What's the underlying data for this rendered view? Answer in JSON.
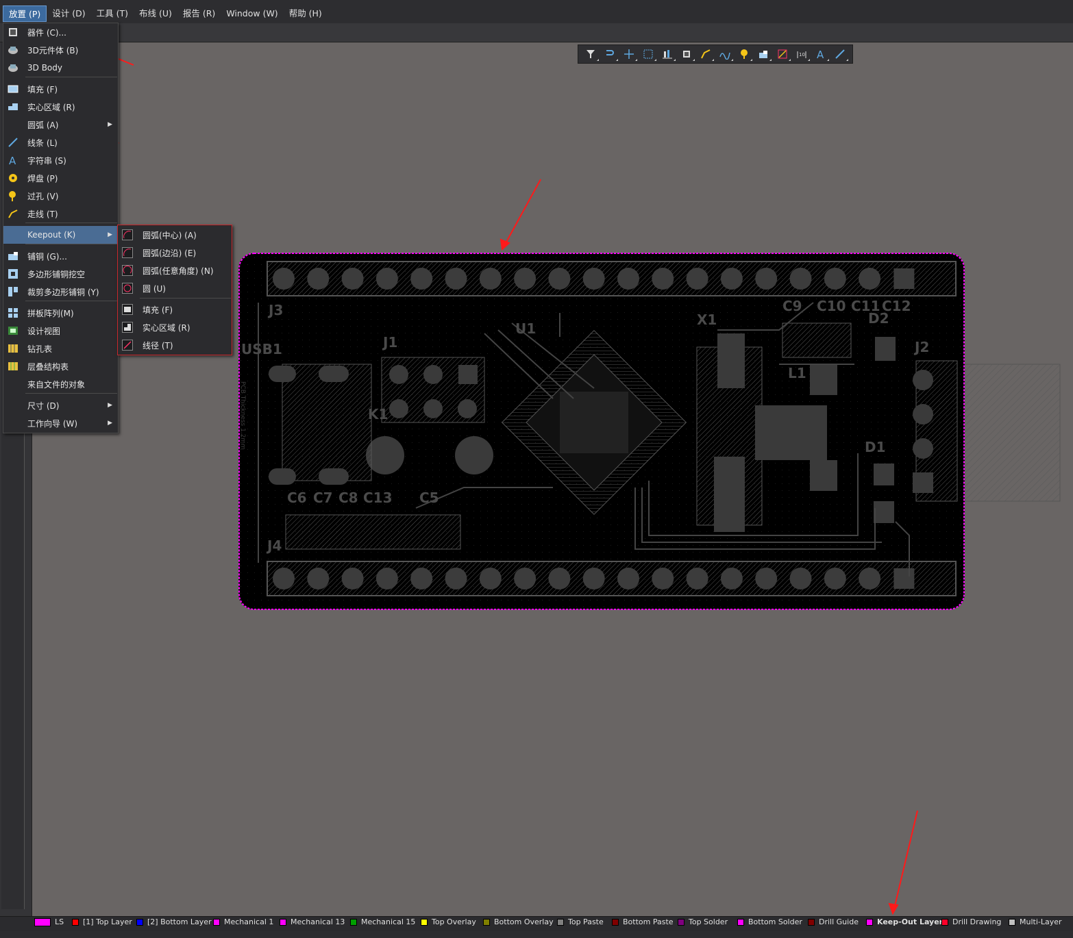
{
  "menubar": {
    "items": [
      "放置 (P)",
      "设计 (D)",
      "工具 (T)",
      "布线 (U)",
      "报告 (R)",
      "Window (W)",
      "帮助 (H)"
    ]
  },
  "place_menu": {
    "items": [
      {
        "label": "器件 (C)...",
        "icon": "component-icon"
      },
      {
        "label": "3D元件体 (B)",
        "icon": "3d-body-icon"
      },
      {
        "label": "3D Body",
        "icon": "3d-body-icon"
      },
      {
        "label": "填充 (F)",
        "icon": "fill-icon"
      },
      {
        "label": "实心区域 (R)",
        "icon": "solid-region-icon"
      },
      {
        "label": "圆弧 (A)",
        "icon": "",
        "submenu": true
      },
      {
        "label": "线条 (L)",
        "icon": "line-icon"
      },
      {
        "label": "字符串 (S)",
        "icon": "string-icon"
      },
      {
        "label": "焊盘 (P)",
        "icon": "pad-icon"
      },
      {
        "label": "过孔 (V)",
        "icon": "via-icon"
      },
      {
        "label": "走线 (T)",
        "icon": "track-icon"
      },
      {
        "label": "Keepout (K)",
        "icon": "",
        "submenu": true
      },
      {
        "label": "铺铜 (G)...",
        "icon": "polygon-pour-icon"
      },
      {
        "label": "多边形铺铜挖空",
        "icon": "polygon-cutout-icon"
      },
      {
        "label": "裁剪多边形铺铜 (Y)",
        "icon": "slice-polygon-icon"
      },
      {
        "label": "拼板阵列(M)",
        "icon": "panel-array-icon"
      },
      {
        "label": "设计视图",
        "icon": "design-view-icon"
      },
      {
        "label": "钻孔表",
        "icon": "drill-table-icon"
      },
      {
        "label": "层叠结构表",
        "icon": "layer-stack-table-icon"
      },
      {
        "label": "来自文件的对象",
        "icon": ""
      },
      {
        "label": "尺寸 (D)",
        "icon": "",
        "submenu": true
      },
      {
        "label": "工作向导 (W)",
        "icon": "",
        "submenu": true
      }
    ]
  },
  "keepout_submenu": {
    "items": [
      {
        "label": "圆弧(中心) (A)",
        "icon": "arc-center-icon"
      },
      {
        "label": "圆弧(边沿) (E)",
        "icon": "arc-edge-icon"
      },
      {
        "label": "圆弧(任意角度) (N)",
        "icon": "arc-any-angle-icon"
      },
      {
        "label": "圆 (U)",
        "icon": "circle-icon"
      },
      {
        "label": "填充 (F)",
        "icon": "fill-icon"
      },
      {
        "label": "实心区域 (R)",
        "icon": "solid-region-icon"
      },
      {
        "label": "线径 (T)",
        "icon": "track-icon"
      }
    ]
  },
  "pcb_toolbar": {
    "icons": [
      "filter-icon",
      "interactive-routing-icon",
      "crosshair-icon",
      "select-rectangle-icon",
      "align-icon",
      "component-icon",
      "route-icon",
      "diff-pair-icon",
      "via-icon",
      "polygon-pour-icon",
      "keepout-icon",
      "dimension-icon",
      "string-icon",
      "line-icon"
    ]
  },
  "pcb": {
    "board_outline_color": "#ff00ff",
    "designators": [
      "J3",
      "USB1",
      "J1",
      "K1",
      "U1",
      "X1",
      "J2",
      "D1",
      "D2",
      "L1",
      "J4",
      "C6",
      "C7",
      "C8",
      "C13",
      "C5",
      "C9",
      "C10",
      "C11",
      "C12"
    ],
    "silk_board_text": "PCB Thickness 1.2mm"
  },
  "layer_tabs": [
    {
      "label": "LS",
      "color": "#ff00ff"
    },
    {
      "label": "[1] Top Layer",
      "color": "#ff0000"
    },
    {
      "label": "[2] Bottom Layer",
      "color": "#0000ff"
    },
    {
      "label": "Mechanical 1",
      "color": "#ff00ff"
    },
    {
      "label": "Mechanical 13",
      "color": "#ff00ff"
    },
    {
      "label": "Mechanical 15",
      "color": "#00a000"
    },
    {
      "label": "Top Overlay",
      "color": "#ffff00"
    },
    {
      "label": "Bottom Overlay",
      "color": "#808000"
    },
    {
      "label": "Top Paste",
      "color": "#808080"
    },
    {
      "label": "Bottom Paste",
      "color": "#800000"
    },
    {
      "label": "Top Solder",
      "color": "#800080"
    },
    {
      "label": "Bottom Solder",
      "color": "#ff00ff"
    },
    {
      "label": "Drill Guide",
      "color": "#800000"
    },
    {
      "label": "Keep-Out Layer",
      "color": "#ff00ff",
      "active": true
    },
    {
      "label": "Drill Drawing",
      "color": "#ff002a"
    },
    {
      "label": "Multi-Layer",
      "color": "#c0c0c0"
    }
  ]
}
